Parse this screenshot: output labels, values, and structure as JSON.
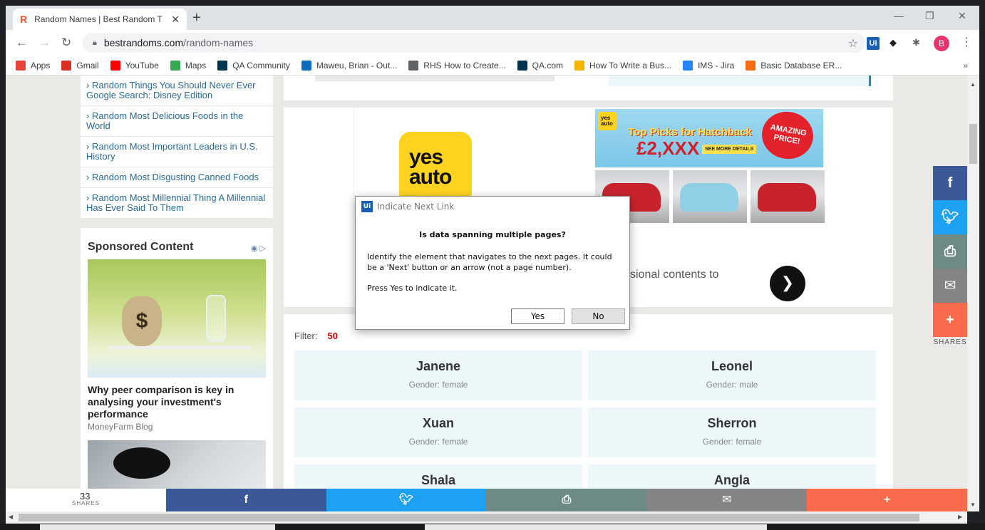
{
  "browser": {
    "tab_title": "Random Names | Best Random T",
    "tab_favicon": "R",
    "url_host": "bestrandoms.com",
    "url_path": "/random-names",
    "profile_initial": "B",
    "bookmarks": [
      {
        "label": "Apps",
        "icon": "apps-grid-icon",
        "color": "#e8453c"
      },
      {
        "label": "Gmail",
        "icon": "gmail-icon",
        "color": "#d93025"
      },
      {
        "label": "YouTube",
        "icon": "youtube-icon",
        "color": "#ff0000"
      },
      {
        "label": "Maps",
        "icon": "maps-pin-icon",
        "color": "#34a853"
      },
      {
        "label": "QA Community",
        "icon": "qa-logo-icon",
        "color": "#00334e"
      },
      {
        "label": "Maweu, Brian - Out...",
        "icon": "outlook-icon",
        "color": "#0f6cbd"
      },
      {
        "label": "RHS How to Create...",
        "icon": "globe-icon",
        "color": "#5f6368"
      },
      {
        "label": "QA.com",
        "icon": "qa-logo-icon",
        "color": "#00334e"
      },
      {
        "label": "How To Write a Bus...",
        "icon": "dots-icon",
        "color": "#f4b400"
      },
      {
        "label": "IMS - Jira",
        "icon": "jira-icon",
        "color": "#2684ff"
      },
      {
        "label": "Basic Database ER...",
        "icon": "lucid-icon",
        "color": "#f96b13"
      }
    ]
  },
  "sidebar": {
    "related": [
      "› Random Things You Should Never Ever Google Search: Disney Edition",
      "› Random Most Delicious Foods in the World",
      "› Random Most Important Leaders in U.S. History",
      "› Random Most Disgusting Canned Foods",
      "› Random Most Millennial Thing A Millennial Has Ever Said To Them"
    ],
    "sponsored_heading": "Sponsored Content",
    "sponsored_title": "Why peer comparison is key in analysing your investment's performance",
    "sponsored_source": "MoneyFarm Blog",
    "money_bag_symbol": "$"
  },
  "ad": {
    "logo_text_1": "yes",
    "logo_text_2": "auto",
    "mini_logo_1": "yes",
    "mini_logo_2": "auto",
    "headline": "Top Picks for Hatchback",
    "price": "£2,XXX",
    "see_more": "SEE MORE DETAILS",
    "burst": "AMAZING PRICE!",
    "partial_text": "sional contents to",
    "car_colors": [
      "#c8232c",
      "#8fd0e6",
      "#c8232c"
    ]
  },
  "list": {
    "filter_label": "Filter:",
    "filter_count": "50",
    "names": [
      {
        "name": "Janene",
        "gender": "Gender: female"
      },
      {
        "name": "Leonel",
        "gender": "Gender: male"
      },
      {
        "name": "Xuan",
        "gender": "Gender: female"
      },
      {
        "name": "Sherron",
        "gender": "Gender: female"
      },
      {
        "name": "Shala",
        "gender": ""
      },
      {
        "name": "Angla",
        "gender": ""
      }
    ]
  },
  "share": {
    "rail_label": "SHARES",
    "count": "33",
    "count_label": "SHARES",
    "colors": {
      "facebook": "#3b5998",
      "twitter": "#1da1f2",
      "print": "#6d8a87",
      "email": "#848484",
      "more": "#fc6a4e"
    }
  },
  "dialog": {
    "title": "Indicate Next Link",
    "logo": "Ui",
    "question": "Is data spanning multiple pages?",
    "body_1": "Identify the element that navigates to the next pages. It could be a 'Next' button or an arrow (not a page number).",
    "body_2": "Press Yes to indicate it.",
    "yes_label": "Yes",
    "no_label": "No"
  }
}
